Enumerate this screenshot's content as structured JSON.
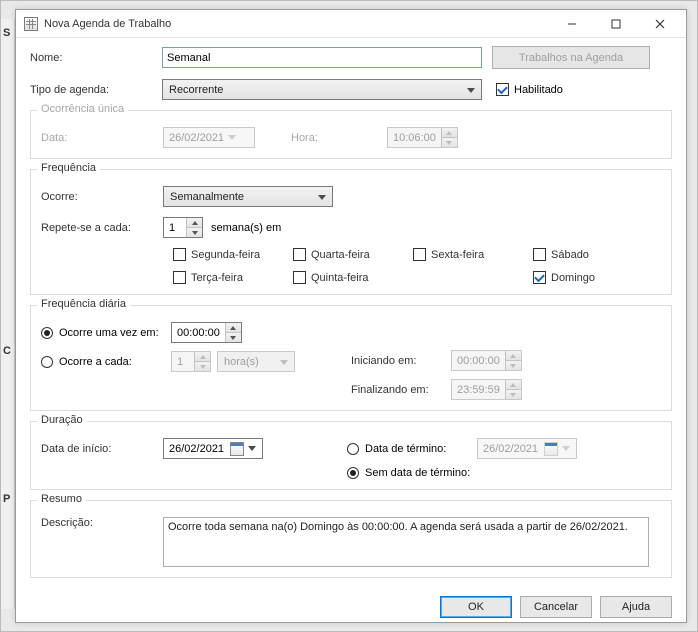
{
  "window": {
    "title": "Nova Agenda de Trabalho"
  },
  "background_markers": {
    "s": "S",
    "c": "C",
    "p": "P"
  },
  "form": {
    "name_label": "Nome:",
    "name_value": "Semanal",
    "jobs_button": "Trabalhos na Agenda",
    "type_label": "Tipo de agenda:",
    "type_value": "Recorrente",
    "enabled_label": "Habilitado",
    "enabled_checked": true
  },
  "single": {
    "legend": "Ocorrência única",
    "date_label": "Data:",
    "date_value": "26/02/2021",
    "time_label": "Hora:",
    "time_value": "10:06:00"
  },
  "freq": {
    "legend": "Frequência",
    "occurs_label": "Ocorre:",
    "occurs_value": "Semanalmente",
    "repeat_label": "Repete-se a cada:",
    "repeat_value": "1",
    "repeat_unit": "semana(s) em",
    "days": {
      "mon": "Segunda-feira",
      "tue": "Terça-feira",
      "wed": "Quarta-feira",
      "thu": "Quinta-feira",
      "fri": "Sexta-feira",
      "sat": "Sábado",
      "sun": "Domingo"
    },
    "days_checked": {
      "mon": false,
      "tue": false,
      "wed": false,
      "thu": false,
      "fri": false,
      "sat": false,
      "sun": true
    }
  },
  "daily": {
    "legend": "Frequência diária",
    "once_label": "Ocorre uma vez em:",
    "once_value": "00:00:00",
    "each_label": "Ocorre a cada:",
    "each_value": "1",
    "each_unit": "hora(s)",
    "start_label": "Iniciando em:",
    "start_value": "00:00:00",
    "end_label": "Finalizando em:",
    "end_value": "23:59:59",
    "selected": "once"
  },
  "duration": {
    "legend": "Duração",
    "start_label": "Data de início:",
    "start_value": "26/02/2021",
    "end_radio_label": "Data de término:",
    "end_value": "26/02/2021",
    "noend_radio_label": "Sem data de término:",
    "selected": "noend"
  },
  "summary": {
    "legend": "Resumo",
    "desc_label": "Descrição:",
    "desc_value": "Ocorre toda semana na(o) Domingo às 00:00:00. A agenda será usada a partir de 26/02/2021."
  },
  "buttons": {
    "ok": "OK",
    "cancel": "Cancelar",
    "help": "Ajuda"
  }
}
